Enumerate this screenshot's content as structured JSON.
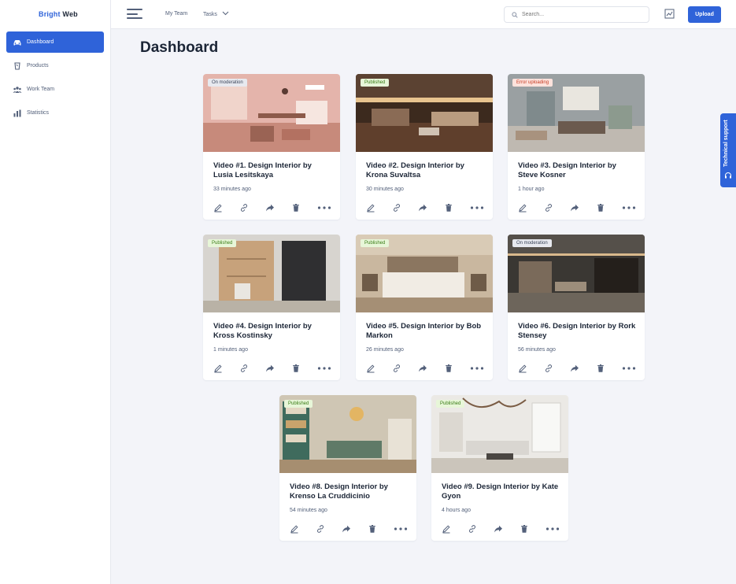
{
  "app": {
    "brand_first": "Bright",
    "brand_second": "Web"
  },
  "sidebar": {
    "items": [
      {
        "label": "Dashboard",
        "icon": "car-icon",
        "active": true
      },
      {
        "label": "Products",
        "icon": "cup-icon",
        "active": false
      },
      {
        "label": "Work Team",
        "icon": "team-icon",
        "active": false
      },
      {
        "label": "Statistics",
        "icon": "chart-icon",
        "active": false
      }
    ]
  },
  "topbar": {
    "my_team": "My Team",
    "tasks": "Tasks",
    "search_placeholder": "Search...",
    "upload": "Upload"
  },
  "page": {
    "title": "Dashboard"
  },
  "support": {
    "label": "Technical support"
  },
  "colors": {
    "accent": "#2f63d9",
    "published": "#3a7d16",
    "error": "#c53b22"
  },
  "videos": [
    {
      "status": "On moderation",
      "status_kind": "moderation",
      "title": "Video #1. Design Interior by Lusia Lesitskaya",
      "time": "33 minutes ago",
      "palette": "pink"
    },
    {
      "status": "Published",
      "status_kind": "published",
      "title": "Video #2. Design Interior by Krona Suvaltsa",
      "time": "30 minutes ago",
      "palette": "wood"
    },
    {
      "status": "Error uploading",
      "status_kind": "error",
      "title": "Video #3. Design Interior by Steve Kosner",
      "time": "1 hour ago",
      "palette": "grey"
    },
    {
      "status": "Published",
      "status_kind": "published",
      "title": "Video #4. Design Interior by Kross Kostinsky",
      "time": "1 minutes ago",
      "palette": "oak"
    },
    {
      "status": "Published",
      "status_kind": "published",
      "title": "Video #5. Design Interior by Bob Markon",
      "time": "26 minutes ago",
      "palette": "bed"
    },
    {
      "status": "On moderation",
      "status_kind": "moderation",
      "title": "Video #6. Design Interior by Rork Stensey",
      "time": "56 minutes ago",
      "palette": "dark"
    },
    {
      "status": "Published",
      "status_kind": "published",
      "title": "Video #8. Design Interior by Krenso La Cruddicinio",
      "time": "54 minutes ago",
      "palette": "green"
    },
    {
      "status": "Published",
      "status_kind": "published",
      "title": "Video #9. Design Interior by Kate Gyon",
      "time": "4 hours ago",
      "palette": "white"
    }
  ]
}
